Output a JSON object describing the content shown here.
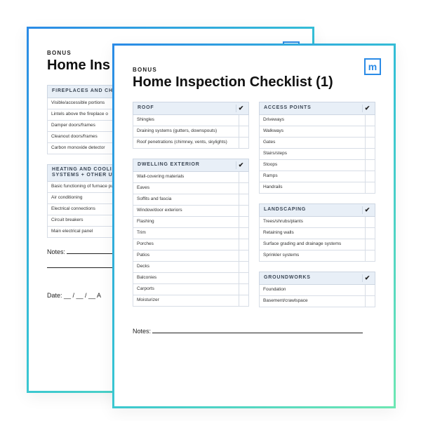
{
  "logo_letter": "m",
  "bonus_label": "BONUS",
  "back": {
    "title": "Home Ins",
    "sections": [
      {
        "name": "FIREPLACES AND CHIMN",
        "items": [
          "Visible/accessible portions",
          "Lintels above the fireplace o",
          "Damper doors/frames",
          "Cleanout doors/frames",
          "Carbon monoxide detector"
        ]
      },
      {
        "name": "HEATING AND COOLING SYSTEMS + OTHER UTILI",
        "items": [
          "Basic functioning of furnace pumps",
          "Air conditioning",
          "Electrical connections",
          "Circuit breakers",
          "Main electrical panel"
        ]
      }
    ],
    "notes_label": "Notes:",
    "date_label": "Date: __ / __ / __     A"
  },
  "front": {
    "title": "Home Inspection Checklist (1)",
    "left_sections": [
      {
        "name": "ROOF",
        "items": [
          "Shingles",
          "Draining systems (gutters, downspouts)",
          "Roof penetrations (chimney, vents, skylights)"
        ]
      },
      {
        "name": "DWELLING EXTERIOR",
        "items": [
          "Wall-covering materials",
          "Eaves",
          "Soffits and fascia",
          "Window/door exteriors",
          "Flashing",
          "Trim",
          "Porches",
          "Patios",
          "Decks",
          "Balconies",
          "Carports",
          "Moisturizer"
        ]
      }
    ],
    "right_sections": [
      {
        "name": "ACCESS POINTS",
        "items": [
          "Driveways",
          "Walkways",
          "Gates",
          "Stairs/steps",
          "Stoops",
          "Ramps",
          "Handrails"
        ]
      },
      {
        "name": "LANDSCAPING",
        "items": [
          "Trees/shrubs/plants",
          "Retaining walls",
          "Surface grading and drainage systems",
          "Sprinkler systems"
        ]
      },
      {
        "name": "GROUNDWORKS",
        "items": [
          "Foundation",
          "Basement/crawlspace"
        ]
      }
    ],
    "notes_label": "Notes:"
  },
  "checkmark": "✔"
}
